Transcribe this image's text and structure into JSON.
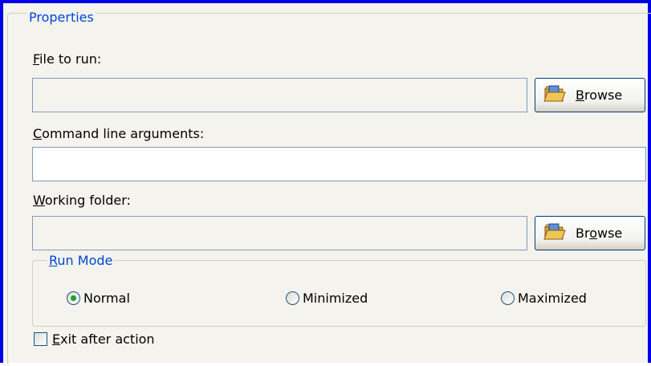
{
  "properties": {
    "legend": "Properties",
    "file_to_run": {
      "label_prefix": "",
      "label_accel": "F",
      "label_rest": "ile to run:",
      "value": "",
      "browse": {
        "accel": "B",
        "rest": "rowse"
      }
    },
    "command_line": {
      "label_accel": "C",
      "label_rest": "ommand line arguments:",
      "value": ""
    },
    "working_folder": {
      "label_accel": "W",
      "label_rest": "orking folder:",
      "value": "",
      "browse": {
        "pre": "Br",
        "accel": "o",
        "rest": "wse"
      }
    },
    "run_mode": {
      "legend_accel": "R",
      "legend_rest": "un Mode",
      "options": [
        {
          "label": "Normal",
          "selected": true
        },
        {
          "label": "Minimized",
          "selected": false
        },
        {
          "label": "Maximized",
          "selected": false
        }
      ]
    },
    "exit_after_action": {
      "accel": "E",
      "rest": "xit after action",
      "checked": false
    }
  },
  "colors": {
    "frame": "#0000e8",
    "legend": "#0046d5",
    "radio_dot": "#21a121",
    "panel": "#f4f3ee"
  },
  "icons": {
    "browse": "folder-open-icon"
  }
}
